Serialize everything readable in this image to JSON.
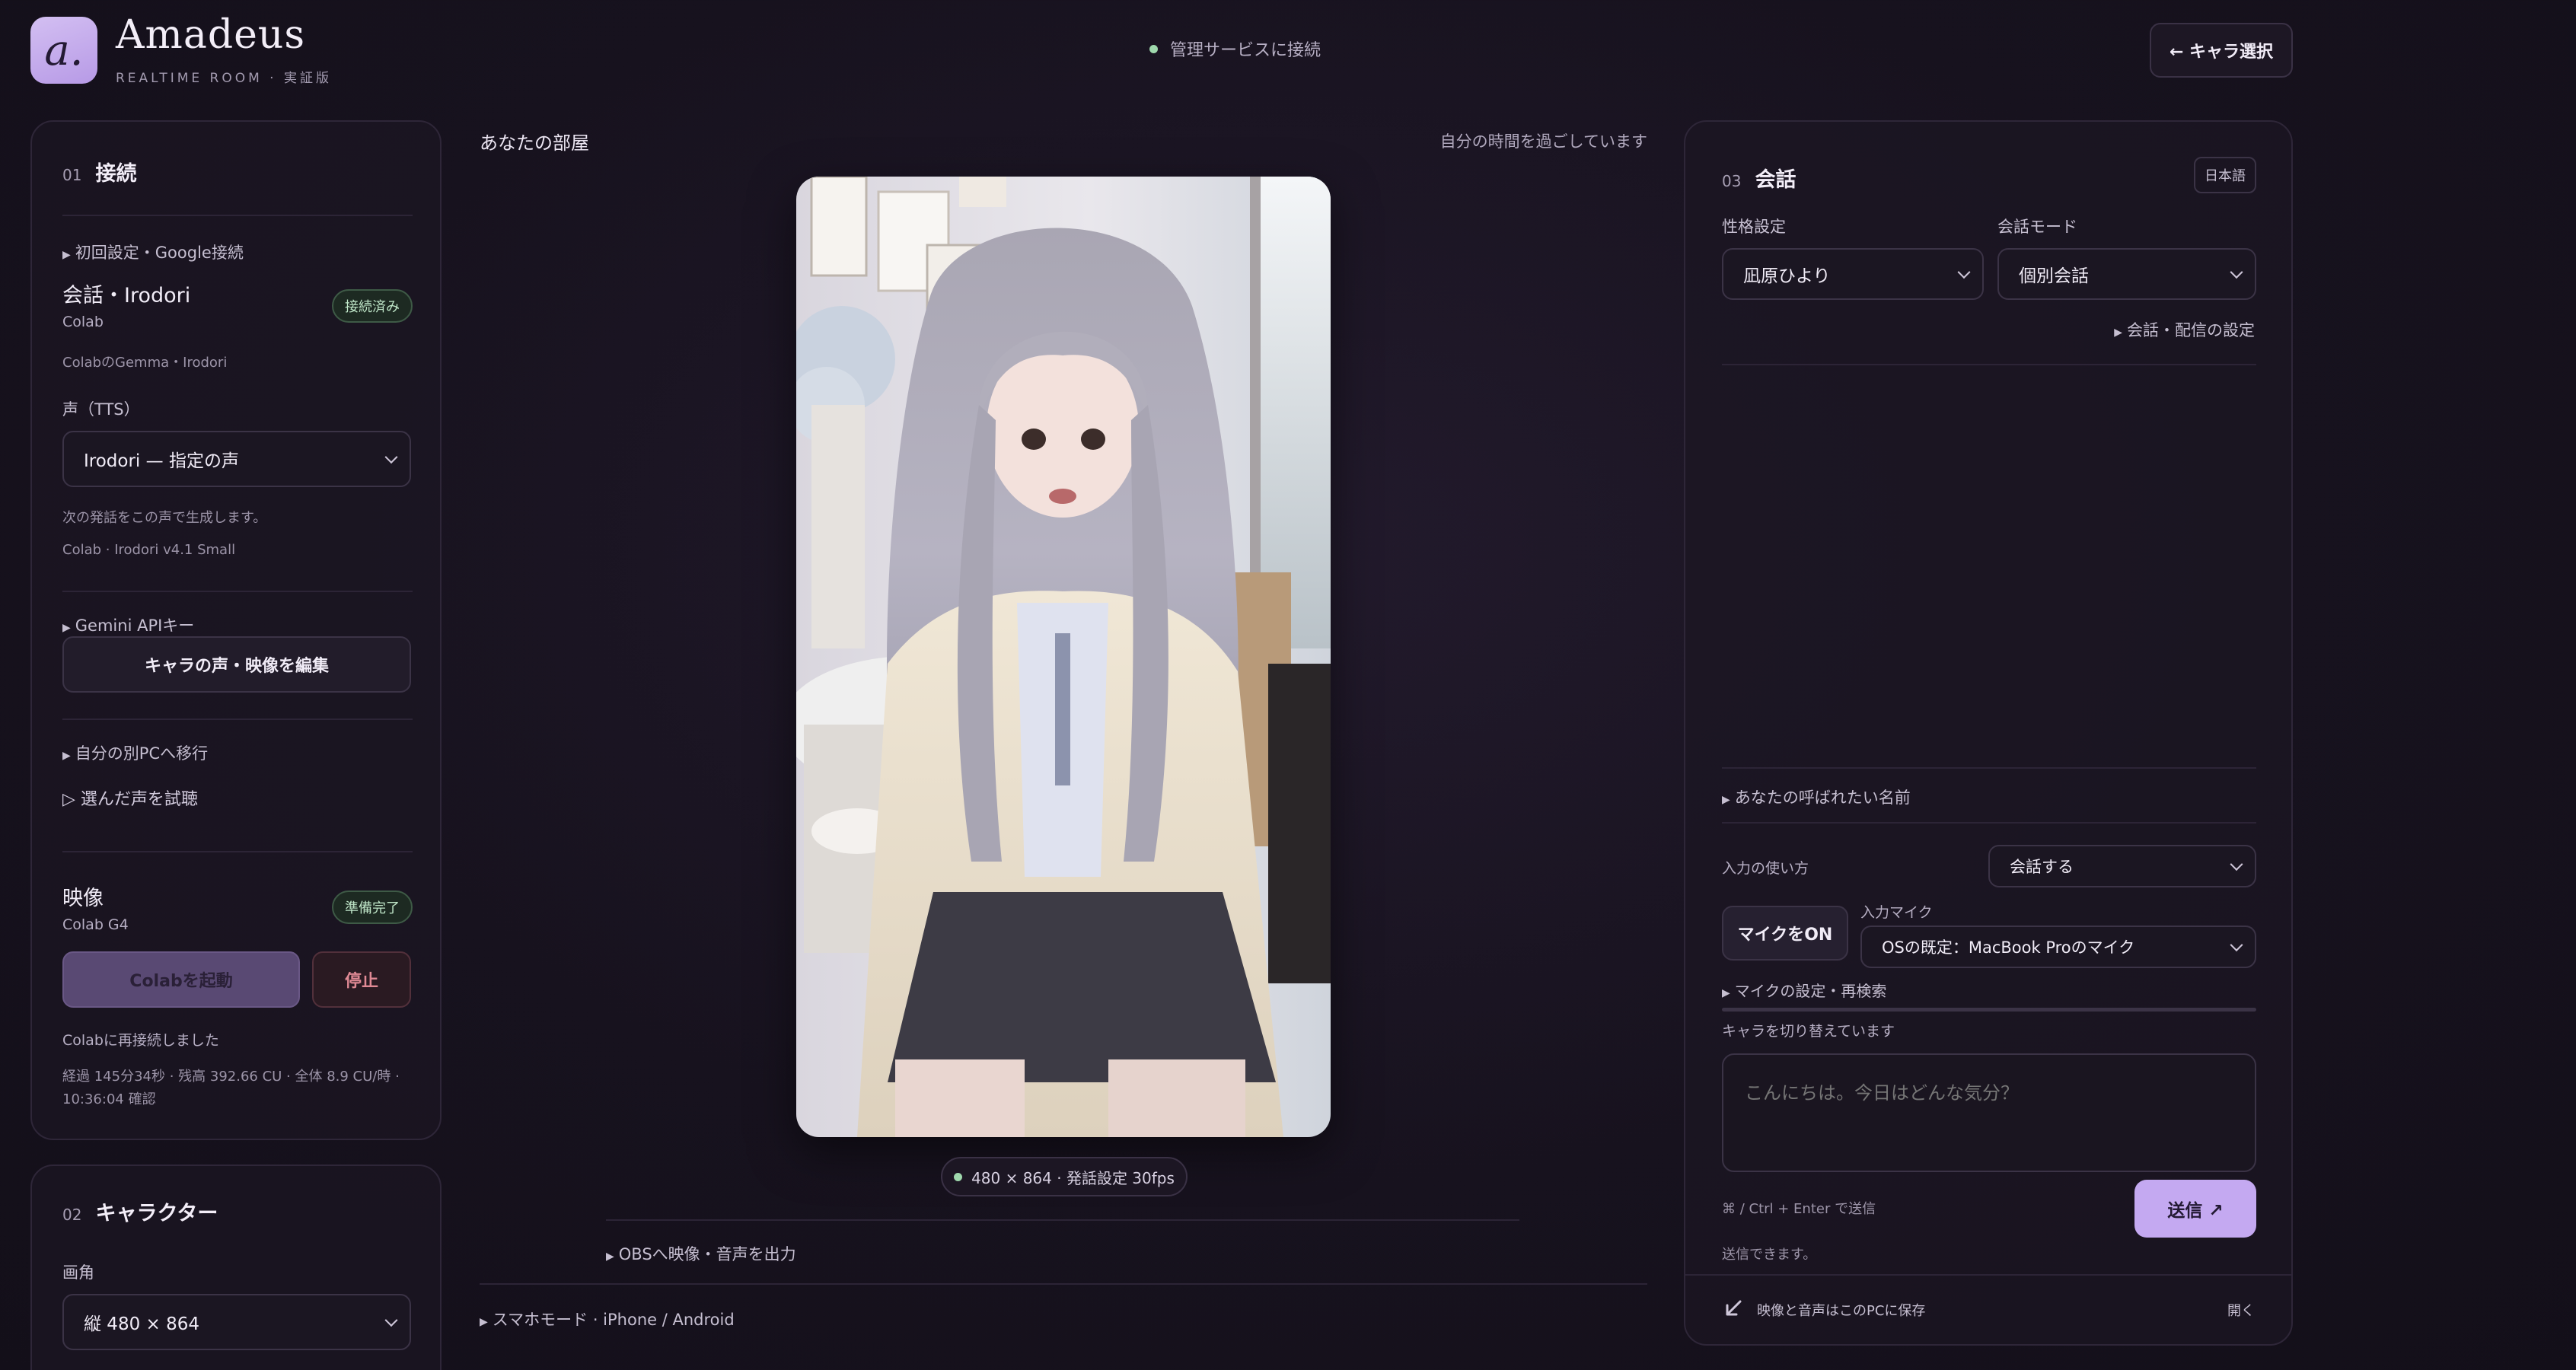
{
  "header": {
    "logo_letter": "a.",
    "title": "Amadeus",
    "subtitle": "REALTIME ROOM · 実証版",
    "status": "管理サービスに接続",
    "back_button": "← キャラ選択"
  },
  "left_panel": {
    "section_num": "01",
    "section_title": "接続",
    "setup_toggle": "初回設定・Google接続",
    "conversation_title": "会話・Irodori",
    "conversation_sub": "Colab",
    "conversation_badge": "接続済み",
    "conversation_desc": "ColabのGemma・Irodori",
    "voice_label": "声（TTS）",
    "voice_select": "Irodori — 指定の声",
    "voice_note": "次の発話をこの声で生成します。",
    "voice_model": "Colab · Irodori v4.1 Small",
    "gemini_toggle": "Gemini APIキー",
    "edit_button": "キャラの声・映像を編集",
    "migrate_toggle": "自分の別PCへ移行",
    "trial_button": "▷ 選んだ声を試聴",
    "video_title": "映像",
    "video_sub": "Colab G4",
    "video_badge": "準備完了",
    "start_button": "Colabを起動",
    "stop_button": "停止",
    "reconnect_msg": "Colabに再接続しました",
    "usage_line1": "経過 145分34秒 · 残高 392.66 CU · 全体 8.9 CU/時 ·",
    "usage_line2": "10:36:04 確認"
  },
  "character_panel": {
    "section_num": "02",
    "section_title": "キャラクター",
    "angle_label": "画角",
    "angle_select": "縦 480 × 864"
  },
  "center": {
    "room_title": "あなたの部屋",
    "room_status": "自分の時間を過ごしています",
    "video_info": "480 × 864 · 発話設定 30fps",
    "obs_toggle": "OBSへ映像・音声を出力",
    "phone_toggle": "スマホモード · iPhone / Android"
  },
  "right_panel": {
    "section_num": "03",
    "section_title": "会話",
    "language_badge": "日本語",
    "personality_label": "性格設定",
    "personality_select": "凪原ひより",
    "mode_label": "会話モード",
    "mode_select": "個別会話",
    "stream_settings_toggle": "会話・配信の設定",
    "name_toggle": "あなたの呼ばれたい名前",
    "input_usage_label": "入力の使い方",
    "input_usage_select": "会話する",
    "mic_button": "マイクをON",
    "mic_input_label": "入力マイク",
    "mic_select": "OSの既定：MacBook Proのマイク",
    "mic_settings_toggle": "マイクの設定・再検索",
    "switching_status": "キャラを切り替えています",
    "message_placeholder": "こんにちは。今日はどんな気分？",
    "send_hint": "⌘ / Ctrl + Enter で送信",
    "send_button": "送信 ↗",
    "can_send": "送信できます。",
    "save_note": "映像と音声はこのPCに保存",
    "open_link": "開く"
  },
  "colors": {
    "background": "#17121e",
    "accent": "#c4a9f1",
    "status_green": "#9fd8ad",
    "stop_red": "#e08a95"
  }
}
